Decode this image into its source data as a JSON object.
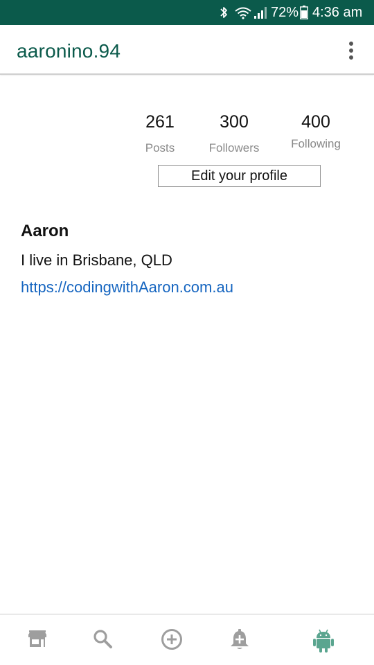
{
  "status_bar": {
    "battery_percent": "72%",
    "time": "4:36 am",
    "icons": [
      "bluetooth-icon",
      "wifi-icon",
      "signal-icon",
      "battery-icon"
    ],
    "background_color": "#0b5a4b"
  },
  "app_bar": {
    "title": "aaronino.94",
    "menu_icon": "more-vert-icon",
    "title_color": "#0b5a4b"
  },
  "profile": {
    "stats": [
      {
        "value": "261",
        "label": "Posts"
      },
      {
        "value": "300",
        "label": "Followers"
      },
      {
        "value": "400",
        "label": "Following"
      }
    ],
    "edit_button_label": "Edit your profile",
    "display_name": "Aaron",
    "bio": "I live in Brisbane, QLD",
    "website": "https://codingwithAaron.com.au",
    "link_color": "#1565c0"
  },
  "bottom_nav": {
    "items": [
      {
        "icon": "store-icon",
        "active": false
      },
      {
        "icon": "search-icon",
        "active": false
      },
      {
        "icon": "add-circle-icon",
        "active": false
      },
      {
        "icon": "notification-add-icon",
        "active": false
      },
      {
        "icon": "android-icon",
        "active": true
      }
    ],
    "inactive_color": "#9e9e9e",
    "active_color": "#5aa58f"
  }
}
